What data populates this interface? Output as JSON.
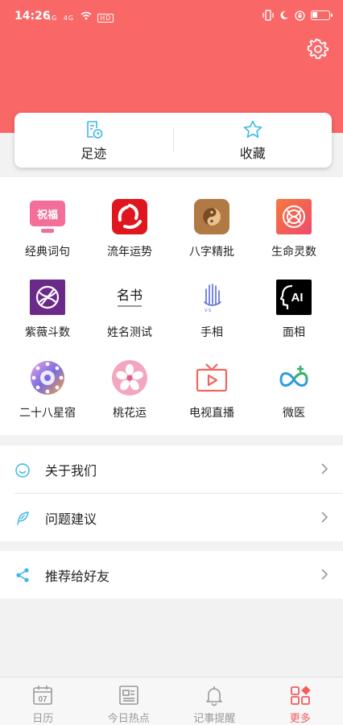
{
  "status_bar": {
    "time": "14:26",
    "network_labels": [
      "4G",
      "4G",
      "HD"
    ],
    "battery_icon": "battery-icon"
  },
  "header": {
    "background": "#f96767",
    "settings_icon": "gear-icon"
  },
  "quick_actions": [
    {
      "label": "足迹",
      "icon": "footprint-icon"
    },
    {
      "label": "收藏",
      "icon": "star-icon"
    }
  ],
  "features": [
    {
      "label": "经典词句",
      "icon": "blessing-icon",
      "icon_text": "祝福"
    },
    {
      "label": "流年运势",
      "icon": "fortune-icon"
    },
    {
      "label": "八字精批",
      "icon": "bazi-icon"
    },
    {
      "label": "生命灵数",
      "icon": "life-number-icon"
    },
    {
      "label": "紫薇斗数",
      "icon": "ziwei-icon"
    },
    {
      "label": "姓名测试",
      "icon": "name-test-icon",
      "icon_text": "名书"
    },
    {
      "label": "手相",
      "icon": "palm-icon"
    },
    {
      "label": "面相",
      "icon": "face-ai-icon",
      "icon_text": "AI"
    },
    {
      "label": "二十八星宿",
      "icon": "constellation-icon"
    },
    {
      "label": "桃花运",
      "icon": "peach-blossom-icon"
    },
    {
      "label": "电视直播",
      "icon": "tv-icon"
    },
    {
      "label": "微医",
      "icon": "weiyi-icon"
    }
  ],
  "menu_group_1": [
    {
      "label": "关于我们",
      "icon": "smile-icon"
    },
    {
      "label": "问题建议",
      "icon": "feather-icon"
    }
  ],
  "menu_group_2": [
    {
      "label": "推荐给好友",
      "icon": "share-icon"
    }
  ],
  "tabbar": [
    {
      "label": "日历",
      "icon": "calendar-icon",
      "date": "07",
      "active": false
    },
    {
      "label": "今日热点",
      "icon": "news-icon",
      "active": false
    },
    {
      "label": "记事提醒",
      "icon": "bell-icon",
      "active": false
    },
    {
      "label": "更多",
      "icon": "more-icon",
      "active": true
    }
  ],
  "colors": {
    "accent": "#f25c5c",
    "icon_blue": "#3cb8e6"
  }
}
